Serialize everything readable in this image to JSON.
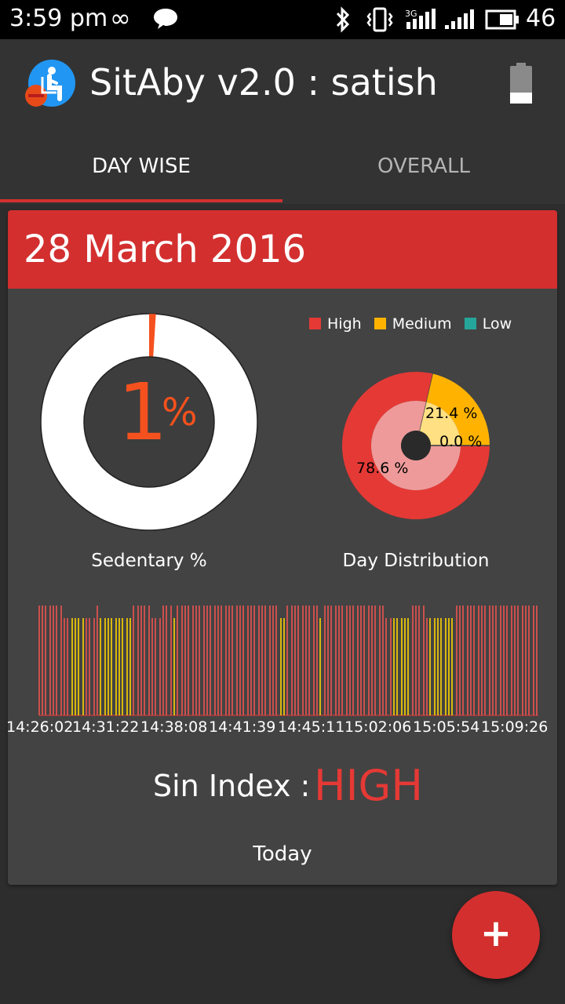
{
  "status_bar": {
    "time": "3:59 pm",
    "infinity_symbol": "∞",
    "signal_3g": "3G",
    "battery_percent": "46"
  },
  "app_bar": {
    "title": "SitAby v2.0 : satish",
    "logo_icon": "sitting-person-icon",
    "battery_icon": "battery-low-icon"
  },
  "tabs": [
    {
      "label": "DAY WISE",
      "selected": true
    },
    {
      "label": "OVERALL",
      "selected": false
    }
  ],
  "card": {
    "date": "28 March 2016",
    "sedentary": {
      "value": "1",
      "unit": "%",
      "fraction": 0.01,
      "label": "Sedentary %"
    },
    "distribution": {
      "legend": [
        {
          "label": "High",
          "color": "#e53935"
        },
        {
          "label": "Medium",
          "color": "#ffb300"
        },
        {
          "label": "Low",
          "color": "#26a69a"
        }
      ],
      "slices": [
        {
          "name": "High",
          "value": 78.6,
          "text": "78.6 %"
        },
        {
          "name": "Medium",
          "value": 21.4,
          "text": "21.4 %"
        },
        {
          "name": "Low",
          "value": 0.0,
          "text": "0.0 %"
        }
      ],
      "caption": "Day Distribution"
    },
    "timeline": {
      "tick_labels": [
        "14:26:02",
        "14:31:22",
        "14:38:08",
        "14:41:39",
        "14:45:11",
        "15:02:06",
        "15:05:54",
        "15:09:26"
      ]
    },
    "sin_index": {
      "label": "Sin Index :",
      "value": "HIGH"
    },
    "period": "Today"
  },
  "fab": {
    "label": "+"
  },
  "colors": {
    "accent": "#d32f2f",
    "high": "#e53935",
    "medium": "#ffb300",
    "low": "#26a69a",
    "sedentary": "#f4511e"
  }
}
